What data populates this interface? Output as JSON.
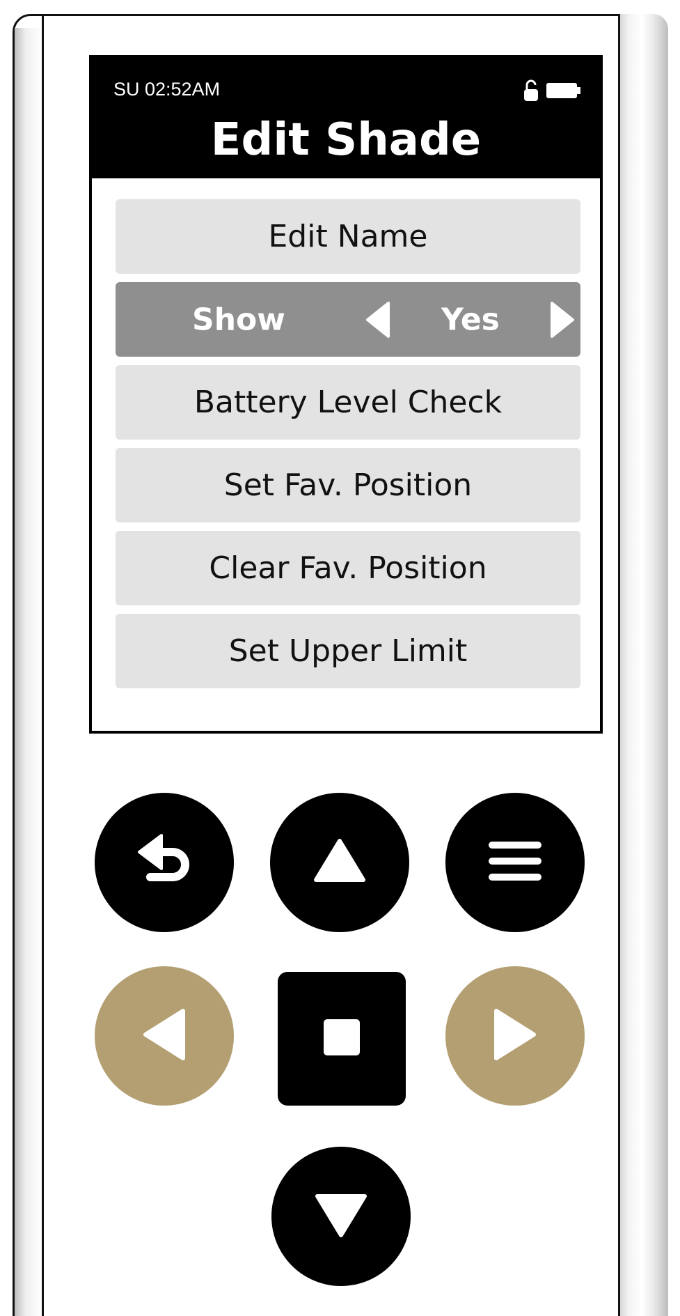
{
  "status_bar": {
    "time": "SU 02:52AM",
    "icons": [
      "unlocked-lock-icon",
      "battery-icon"
    ]
  },
  "screen": {
    "title": "Edit Shade"
  },
  "menu": {
    "items": [
      {
        "label": "Edit Name"
      },
      {
        "label": "Show",
        "value": "Yes",
        "type": "toggle"
      },
      {
        "label": "Battery Level Check"
      },
      {
        "label": "Set Fav. Position"
      },
      {
        "label": "Clear Fav. Position"
      },
      {
        "label": "Set Upper Limit"
      }
    ]
  },
  "buttons": {
    "back": {
      "icon": "back-arrow-icon"
    },
    "up": {
      "icon": "triangle-up-icon"
    },
    "menu": {
      "icon": "hamburger-menu-icon"
    },
    "left": {
      "icon": "triangle-left-icon"
    },
    "stop": {
      "icon": "square-stop-icon"
    },
    "right": {
      "icon": "triangle-right-icon"
    },
    "down": {
      "icon": "triangle-down-icon"
    }
  },
  "colors": {
    "screen_header": "#000000",
    "menu_item": "#e3e3e3",
    "menu_item_selected": "#8f8f8f",
    "button_dark": "#000000",
    "button_gold": "#b39f72"
  }
}
